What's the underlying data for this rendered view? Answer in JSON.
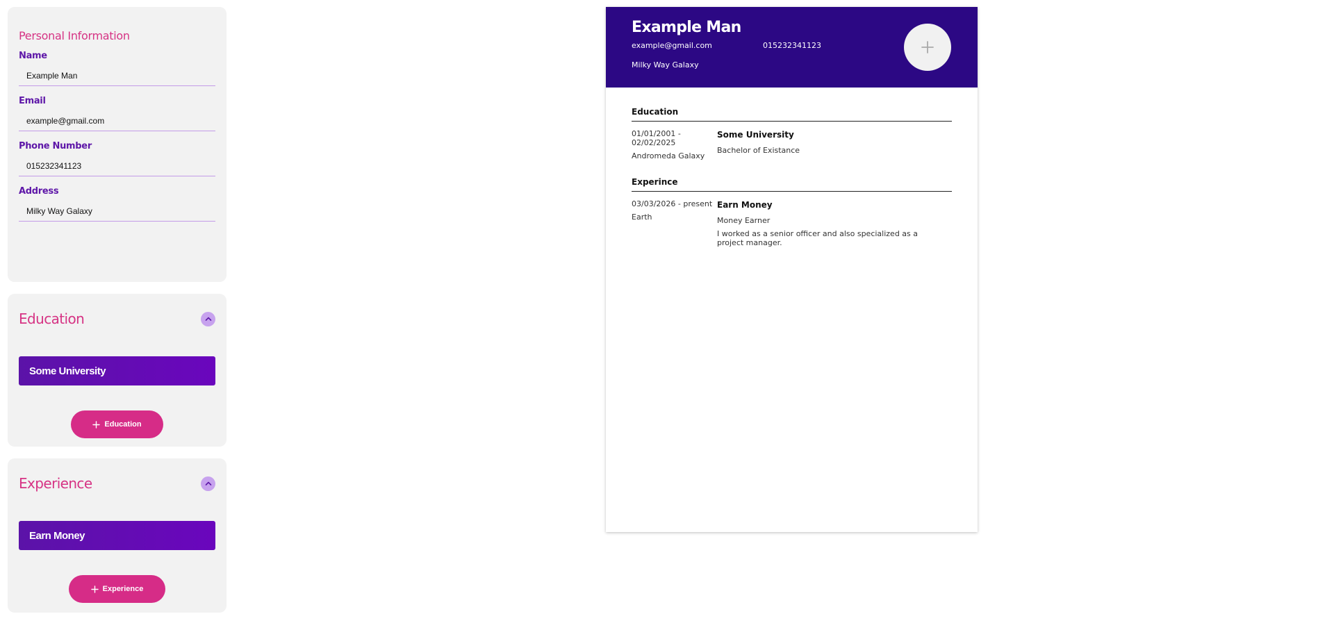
{
  "personal": {
    "heading": "Personal Information",
    "fields": {
      "name": {
        "label": "Name",
        "value": "Example Man"
      },
      "email": {
        "label": "Email",
        "value": "example@gmail.com"
      },
      "phone": {
        "label": "Phone Number",
        "value": "015232341123"
      },
      "address": {
        "label": "Address",
        "value": "Milky Way Galaxy"
      }
    }
  },
  "education_panel": {
    "title": "Education",
    "items": [
      "Some University"
    ],
    "add_label": "Education"
  },
  "experience_panel": {
    "title": "Experience",
    "items": [
      "Earn Money"
    ],
    "add_label": "Experience"
  },
  "cv": {
    "name": "Example Man",
    "email": "example@gmail.com",
    "phone": "015232341123",
    "address": "Milky Way Galaxy",
    "education": {
      "title": "Education",
      "entries": [
        {
          "dates": "01/01/2001 - 02/02/2025",
          "location": "Andromeda Galaxy",
          "school": "Some University",
          "degree": "Bachelor of Existance"
        }
      ]
    },
    "experience": {
      "title": "Experince",
      "entries": [
        {
          "dates": "03/03/2026 - present",
          "location": "Earth",
          "company": "Earn Money",
          "position": "Money Earner",
          "description": "I worked as a senior officer and also specialized as a project manager."
        }
      ]
    }
  },
  "colors": {
    "accent_pink": "#d63384",
    "accent_purple": "#5e17a8",
    "header_navy": "#2c0884",
    "panel_bg": "#f2f2f2"
  },
  "icons": {
    "collapse": "chevron-up-icon",
    "add": "plus-icon",
    "avatar": "plus-icon"
  }
}
